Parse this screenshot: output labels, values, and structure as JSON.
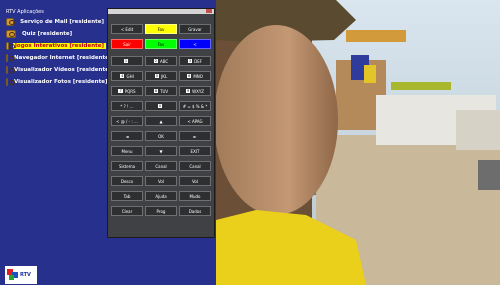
{
  "app_title": "RTV Aplicações",
  "menu": [
    {
      "label": "Serviço de Mail [residente]",
      "icon": "app-icon"
    },
    {
      "label": "Quiz [residente]",
      "icon": "app-icon"
    },
    {
      "label": "Jogos Interativos [residente]",
      "icon": "app-icon",
      "selected": true
    },
    {
      "label": "Navegador Internet [residente]",
      "icon": "app-icon"
    },
    {
      "label": "Visualizador Vídeos [residente]",
      "icon": "app-icon"
    },
    {
      "label": "Visualizador Fotos [residente]",
      "icon": "app-icon"
    }
  ],
  "keypad": {
    "color_row1": [
      "< Edit",
      "Fav",
      "Gravar"
    ],
    "color_row2": [
      "Sair",
      "Fav",
      "<"
    ],
    "rows": [
      [
        {
          "num": "1",
          "label": ""
        },
        {
          "num": "2",
          "label": "ABC"
        },
        {
          "num": "3",
          "label": "DEF"
        }
      ],
      [
        {
          "num": "4",
          "label": "GHI"
        },
        {
          "num": "5",
          "label": "JKL"
        },
        {
          "num": "6",
          "label": "MNO"
        }
      ],
      [
        {
          "num": "7",
          "label": "PQRS"
        },
        {
          "num": "8",
          "label": "TUV"
        },
        {
          "num": "9",
          "label": "WXYZ"
        }
      ],
      [
        {
          "num": "",
          "label": "* ? ! ..."
        },
        {
          "num": "0",
          "label": ""
        },
        {
          "num": "",
          "label": "# = $ % & *"
        }
      ],
      [
        {
          "num": "",
          "label": "< @ / - : ..."
        },
        {
          "num": "",
          "label": "▲"
        },
        {
          "num": "",
          "label": "< APAG"
        }
      ],
      [
        {
          "num": "",
          "label": "◄"
        },
        {
          "num": "",
          "label": "OK"
        },
        {
          "num": "",
          "label": "►"
        }
      ],
      [
        {
          "num": "",
          "label": "Menu"
        },
        {
          "num": "",
          "label": "▼"
        },
        {
          "num": "",
          "label": "EXIT"
        }
      ],
      [
        {
          "num": "",
          "label": "Sistema"
        },
        {
          "num": "",
          "label": "Canal"
        },
        {
          "num": "",
          "label": "Canal"
        }
      ],
      [
        {
          "num": "",
          "label": "Desco"
        },
        {
          "num": "",
          "label": "Vol"
        },
        {
          "num": "",
          "label": "Vol"
        }
      ],
      [
        {
          "num": "",
          "label": "Tab"
        },
        {
          "num": "",
          "label": "Ajuda"
        },
        {
          "num": "",
          "label": "Mudo"
        }
      ],
      [
        {
          "num": "",
          "label": "Clear"
        },
        {
          "num": "",
          "label": "Prog"
        },
        {
          "num": "",
          "label": "Dados"
        }
      ]
    ]
  },
  "logo_text": "RTV",
  "colors": {
    "panel_bg": "#27308c",
    "selected_bg": "#ffff00",
    "selected_text": "#c00000"
  }
}
